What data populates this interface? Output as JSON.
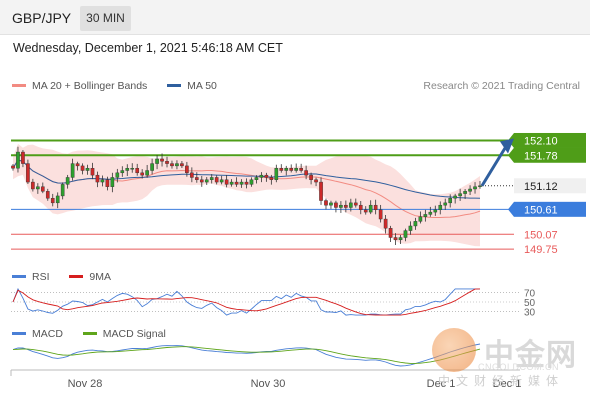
{
  "header": {
    "symbol": "GBP/JPY",
    "timeframe": "30 MIN"
  },
  "timestamp": "Wednesday, December 1, 2021 5:46:18 AM CET",
  "credit": "Research © 2021 Trading Central",
  "watermark": {
    "name": "中金网",
    "url": "CNGOLDCOM.CN",
    "tagline": "中文财经新媒体"
  },
  "colors": {
    "candle_up": "#2e9e2e",
    "candle_down": "#cc2a2a",
    "ma20": "#f28b82",
    "bollinger_fill": "#fbe0de",
    "ma50": "#2f5f9e",
    "resistance": "#4f9d18",
    "pivot": "#3b7ddd",
    "support": "#e85a5a",
    "current": "#222222",
    "rsi": "#4a7fd6",
    "rsi_ma": "#d61e1e",
    "macd": "#4a7fd6",
    "macd_signal": "#5fa51b"
  },
  "chart_data": [
    {
      "type": "candlestick",
      "name": "price",
      "legend": [
        {
          "label": "MA 20 + Bollinger Bands",
          "color": "#f28b82"
        },
        {
          "label": "MA 50",
          "color": "#2f5f9e"
        }
      ],
      "ylim": [
        149.6,
        152.5
      ],
      "x_tick_labels": [
        {
          "label": "Nov 28",
          "index": 6
        },
        {
          "label": "Nov 30",
          "index": 22
        },
        {
          "label": "Dec 1",
          "index": 36
        }
      ],
      "close": [
        151.5,
        151.85,
        151.6,
        151.2,
        151.05,
        151.1,
        151.0,
        150.85,
        150.75,
        150.9,
        151.15,
        151.3,
        151.6,
        151.55,
        151.45,
        151.5,
        151.35,
        151.2,
        151.25,
        151.1,
        151.3,
        151.4,
        151.45,
        151.5,
        151.5,
        151.4,
        151.35,
        151.45,
        151.6,
        151.7,
        151.65,
        151.6,
        151.55,
        151.6,
        151.55,
        151.4,
        151.3,
        151.25,
        151.2,
        151.25,
        151.3,
        151.2,
        151.25,
        151.15,
        151.2,
        151.15,
        151.2,
        151.15,
        151.25,
        151.3,
        151.35,
        151.3,
        151.25,
        151.5,
        151.45,
        151.5,
        151.45,
        151.5,
        151.45,
        151.35,
        151.25,
        151.2,
        150.8,
        150.7,
        150.75,
        150.65,
        150.7,
        150.65,
        150.75,
        150.7,
        150.6,
        150.55,
        150.7,
        150.6,
        150.4,
        150.2,
        150.0,
        149.95,
        150.0,
        150.15,
        150.25,
        150.35,
        150.45,
        150.5,
        150.55,
        150.6,
        150.7,
        150.75,
        150.85,
        150.9,
        150.95,
        151.0,
        151.05,
        151.1,
        151.12
      ],
      "levels": [
        {
          "value": 152.1,
          "label": "152.10",
          "kind": "resistance"
        },
        {
          "value": 151.78,
          "label": "151.78",
          "kind": "resistance"
        },
        {
          "value": 151.12,
          "label": "151.12",
          "kind": "current"
        },
        {
          "value": 150.61,
          "label": "150.61",
          "kind": "pivot"
        },
        {
          "value": 150.07,
          "label": "150.07",
          "kind": "support"
        },
        {
          "value": 149.75,
          "label": "149.75",
          "kind": "support"
        }
      ],
      "projection": {
        "from": 151.12,
        "to": 152.1
      }
    },
    {
      "type": "line",
      "name": "rsi",
      "legend": [
        {
          "label": "RSI",
          "color": "#4a7fd6"
        },
        {
          "label": "9MA",
          "color": "#d61e1e"
        }
      ],
      "ylim": [
        20,
        80
      ],
      "y_tick_labels": [
        "70",
        "50",
        "30"
      ],
      "y_ticks": [
        70,
        50,
        30
      ]
    },
    {
      "type": "line",
      "name": "macd",
      "legend": [
        {
          "label": "MACD",
          "color": "#4a7fd6"
        },
        {
          "label": "MACD Signal",
          "color": "#5fa51b"
        }
      ]
    }
  ],
  "xaxis": {
    "labels": [
      {
        "label": "Nov 28"
      },
      {
        "label": "Nov 30"
      },
      {
        "label": "Dec 1"
      },
      {
        "label": "Dec 1"
      }
    ]
  }
}
